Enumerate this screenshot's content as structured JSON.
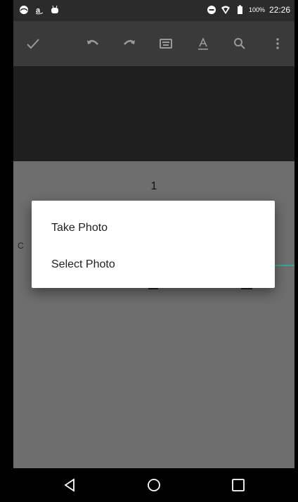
{
  "status_bar": {
    "left_icons": [
      "browser-icon",
      "amazon-icon",
      "android-icon"
    ],
    "battery": "100%",
    "time": "22:26"
  },
  "toolbar": {
    "icons": [
      "check-icon",
      "undo-icon",
      "redo-icon",
      "keyboard-icon",
      "text-format-icon",
      "search-icon",
      "more-vert-icon"
    ]
  },
  "document": {
    "page_number": "1",
    "partial_left_text": "C"
  },
  "dialog": {
    "options": [
      "Take Photo",
      "Select Photo"
    ]
  },
  "nav_bar": {
    "icons": [
      "back-icon",
      "home-icon",
      "recents-icon"
    ]
  },
  "colors": {
    "statusbar": "#2b2b2b",
    "toolbar": "#3a3a3a",
    "dim_overlay": "#6e6e6e",
    "accent": "#3aa69a",
    "dialog": "#ffffff"
  }
}
